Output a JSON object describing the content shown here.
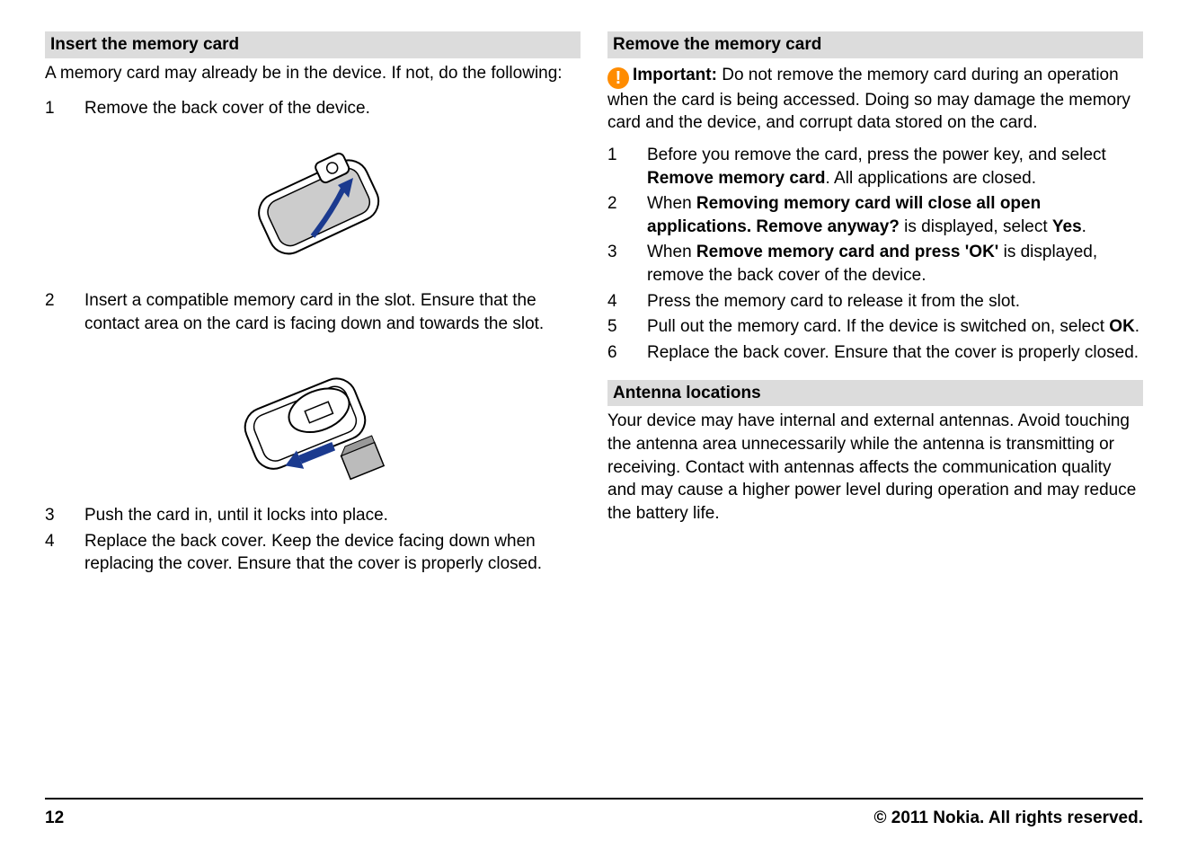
{
  "left": {
    "header1": "Insert the memory card",
    "intro1": "A memory card may already be in the device. If not, do the following:",
    "step1_num": "1",
    "step1_text": "Remove the back cover of the device.",
    "step2_num": "2",
    "step2_text": "Insert a compatible memory card in the slot. Ensure that the contact area on the card is facing down and towards the slot.",
    "step3_num": "3",
    "step3_text": "Push the card in, until it locks into place.",
    "step4_num": "4",
    "step4_text": "Replace the back cover. Keep the device facing down when replacing the cover. Ensure that the cover is properly closed."
  },
  "right": {
    "header1": "Remove the memory card",
    "important_label": "Important:",
    "important_text": " Do not remove the memory card during an operation when the card is being accessed. Doing so may damage the memory card and the device, and corrupt data stored on the card.",
    "r1_num": "1",
    "r1_a": "Before you remove the card, press the power key, and select ",
    "r1_b": "Remove memory card",
    "r1_c": ". All applications are closed.",
    "r2_num": "2",
    "r2_a": "When ",
    "r2_b": "Removing memory card will close all open applications. Remove anyway?",
    "r2_c": " is displayed, select ",
    "r2_d": "Yes",
    "r2_e": ".",
    "r3_num": "3",
    "r3_a": "When ",
    "r3_b": "Remove memory card and press 'OK'",
    "r3_c": " is displayed, remove the back cover of the device.",
    "r4_num": "4",
    "r4_text": "Press the memory card to release it from the slot.",
    "r5_num": "5",
    "r5_a": "Pull out the memory card. If the device is switched on, select ",
    "r5_b": "OK",
    "r5_c": ".",
    "r6_num": "6",
    "r6_text": "Replace the back cover. Ensure that the cover is properly closed.",
    "header2": "Antenna locations",
    "antenna_text": "Your device may have internal and external antennas. Avoid touching the antenna area unnecessarily while the antenna is transmitting or receiving. Contact with antennas affects the communication quality and may cause a higher power level during operation and may reduce the battery life."
  },
  "footer": {
    "page": "12",
    "copyright": "© 2011 Nokia. All rights reserved."
  }
}
